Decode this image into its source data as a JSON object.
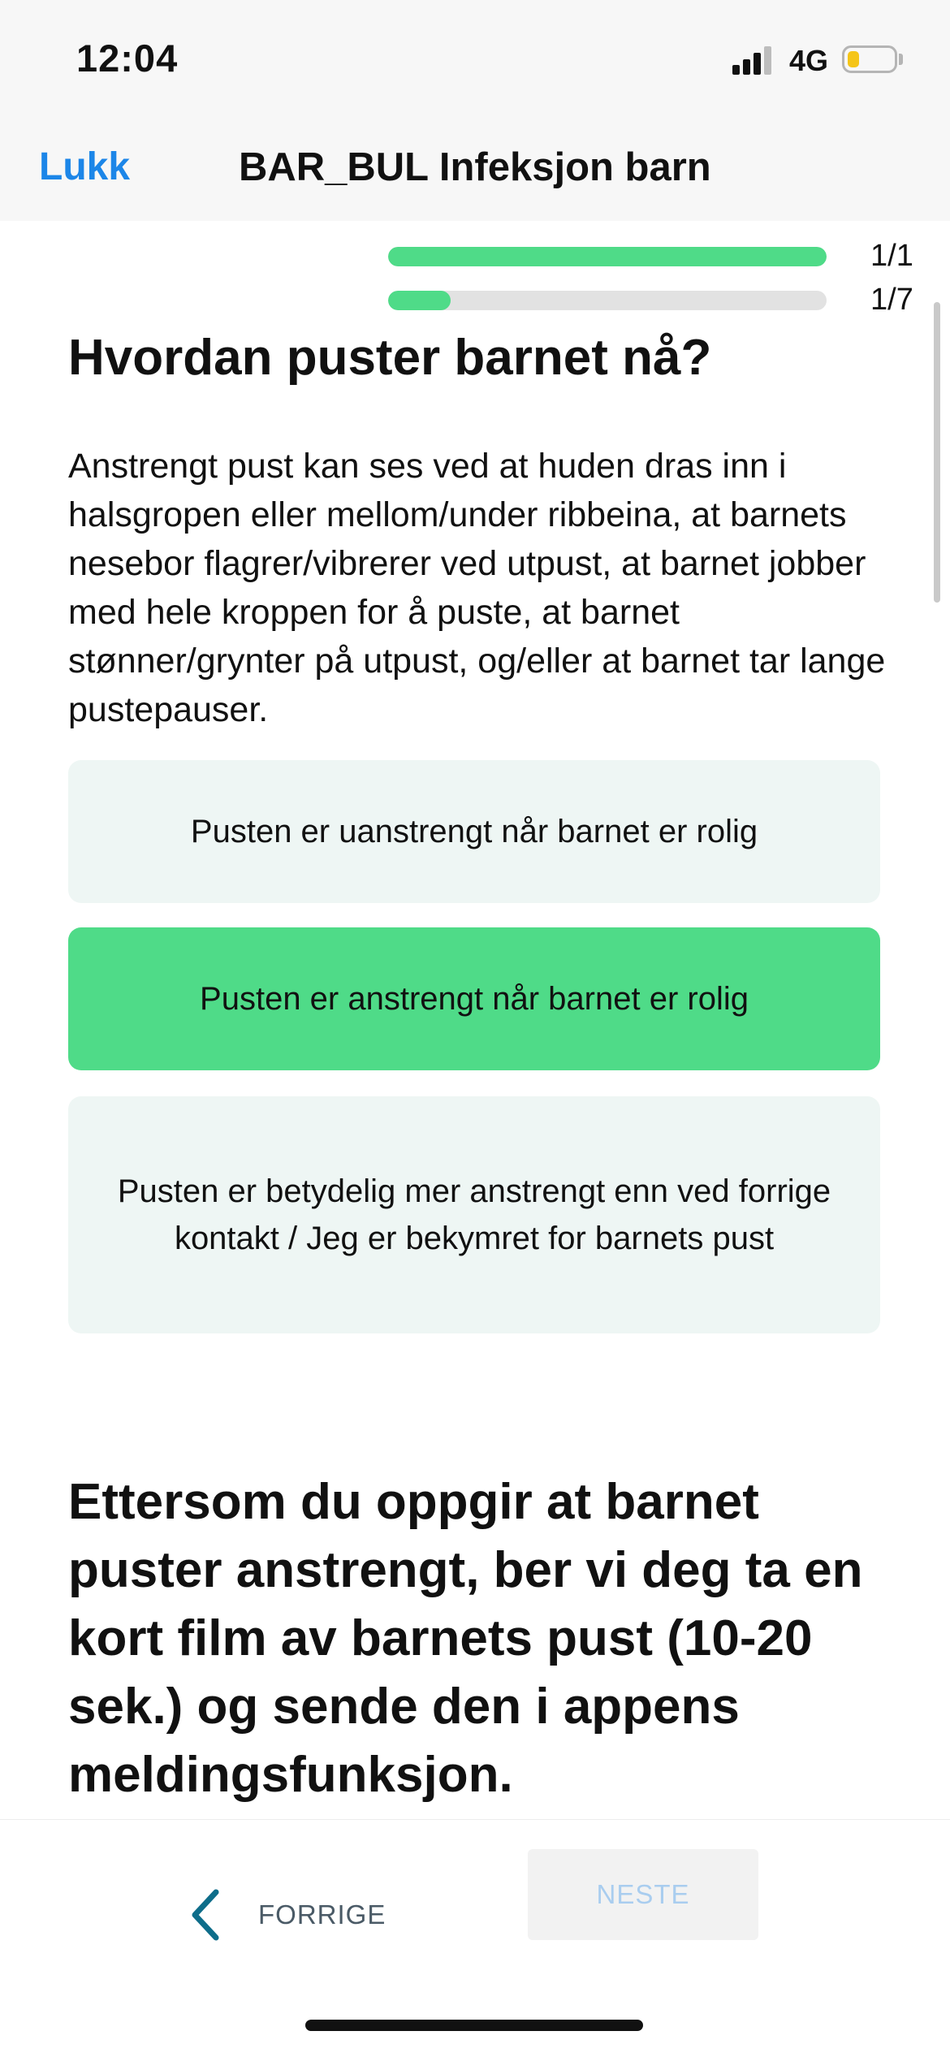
{
  "status_bar": {
    "time": "12:04",
    "network": "4G",
    "battery_level": 0.25,
    "battery_color": "#f5c518",
    "signal_icon": "cellular-signal-icon",
    "battery_icon": "battery-icon"
  },
  "nav": {
    "close_label": "Lukk",
    "title": "BAR_BUL Infeksjon barn",
    "accent_color": "#1c86e8"
  },
  "progress": [
    {
      "label": "1/1",
      "fraction": 1.0
    },
    {
      "label": "1/7",
      "fraction": 0.142857
    }
  ],
  "question": {
    "title": "Hvordan puster barnet nå?",
    "description": "Anstrengt pust kan ses ved at huden dras inn i halsgropen eller mellom/under ribbeina, at barnets nesebor flagrer/vibrerer ved utpust, at barnet jobber med hele kroppen for å puste, at barnet stønner/grynter på utpust, og/eller at barnet tar lange pustepauser.",
    "options": [
      {
        "label": "Pusten er uanstrengt når barnet er rolig",
        "selected": false
      },
      {
        "label": "Pusten er anstrengt når barnet er rolig",
        "selected": true
      },
      {
        "label": "Pusten er betydelig mer anstrengt enn ved forrige kontakt / Jeg er bekymret for barnets pust",
        "selected": false
      }
    ],
    "selected_color": "#4fdb88"
  },
  "info_text": "Ettersom du oppgir at barnet puster anstrengt, ber vi deg ta en kort film av barnets pust (10-20 sek.) og sende den i appens meldingsfunksjon.",
  "footer": {
    "prev_label": "FORRIGE",
    "next_label": "NESTE",
    "prev_icon": "chevron-left-icon"
  }
}
